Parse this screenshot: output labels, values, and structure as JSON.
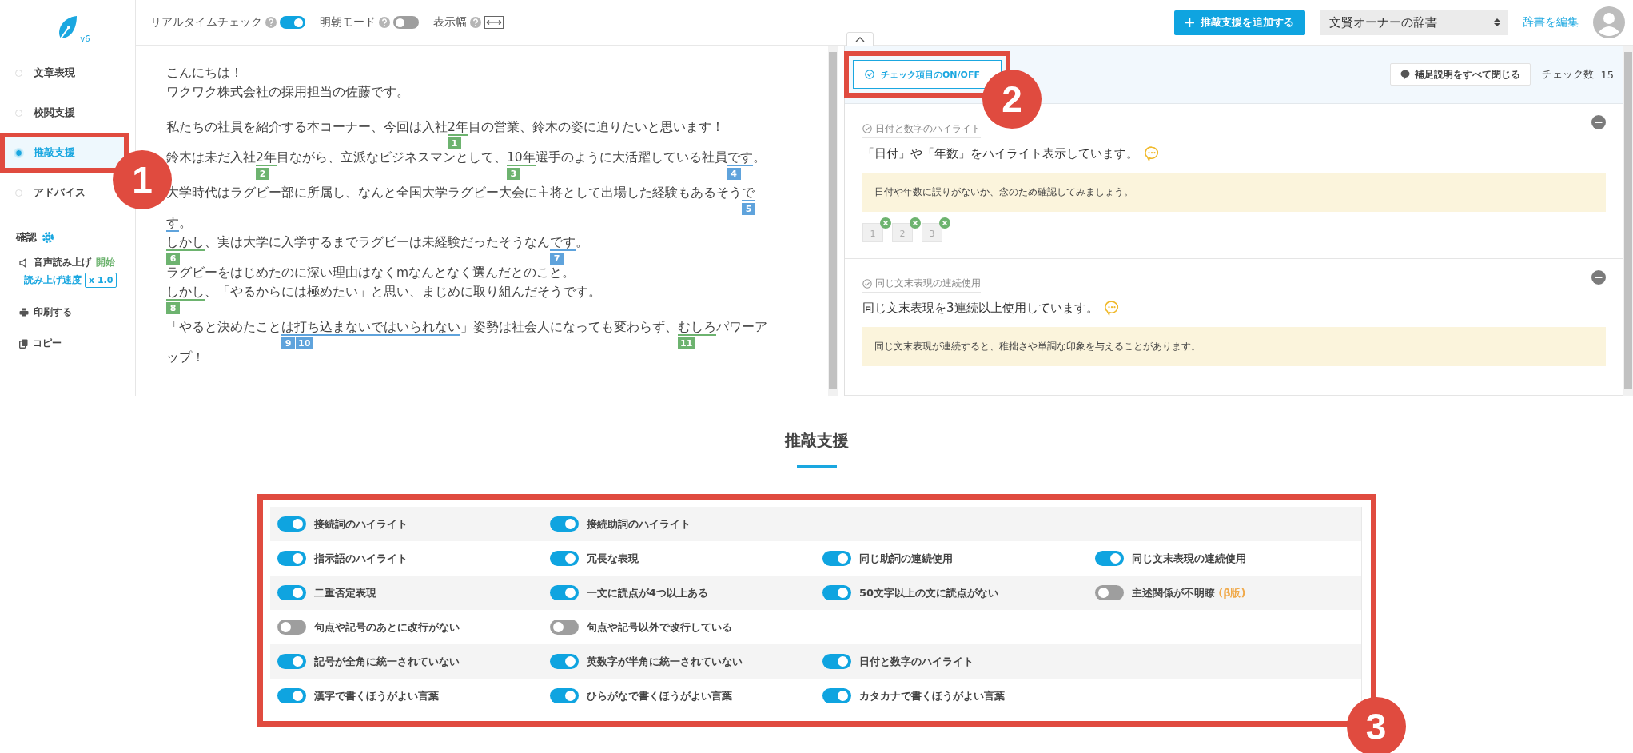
{
  "sidebar": {
    "logo_version": "v6",
    "nav": [
      {
        "label": "文章表現",
        "selected": false
      },
      {
        "label": "校閲支援",
        "selected": false
      },
      {
        "label": "推敲支援",
        "selected": true,
        "annotation": "1"
      },
      {
        "label": "アドバイス",
        "selected": false
      }
    ],
    "confirm": {
      "title": "確認",
      "speech_label": "音声読み上げ",
      "speech_action": "開始",
      "speed_label": "読み上げ速度",
      "speed": "x 1.0",
      "print": "印刷する",
      "copy": "コピー"
    }
  },
  "toolbar": {
    "toggles": [
      {
        "label": "リアルタイムチェック",
        "kind": "switch",
        "on": true
      },
      {
        "label": "明朝モード",
        "kind": "switch",
        "on": false
      },
      {
        "label": "表示幅",
        "kind": "width"
      }
    ],
    "add_button": "推敲支援を追加する",
    "dictionary": "文賢オーナーの辞書",
    "edit_link": "辞書を編集"
  },
  "editor": {
    "paragraphs": [
      {
        "lines": [
          [
            {
              "text": "こんにちは！"
            }
          ],
          [
            {
              "text": "ワクワク株式会社の採用担当の佐藤です。"
            }
          ]
        ]
      },
      {
        "lines": [
          [
            {
              "text": "私たちの社員を紹介する本コーナー、今回は入社"
            },
            {
              "text": "2年",
              "color": "#6db36f",
              "marks": [
                "1"
              ]
            },
            {
              "text": "目の営業、鈴木の姿に迫りたいと思います！"
            }
          ],
          [
            {
              "text": "鈴木は未だ入社"
            },
            {
              "text": "2年",
              "color": "#6db36f",
              "marks": [
                "2"
              ]
            },
            {
              "text": "目ながら、立派なビジネスマンとして、"
            },
            {
              "text": "10年",
              "color": "#6db36f",
              "marks": [
                "3"
              ]
            },
            {
              "text": "選手のように大活躍している社員"
            },
            {
              "text": "です",
              "color": "#5fa3dc",
              "marks": [
                "4"
              ]
            },
            {
              "text": "。"
            }
          ]
        ]
      },
      {
        "lines": [
          [
            {
              "text": "大学時代はラグビー部に所属し、なんと全国大学ラグビー大会に主将として出場した経験もあるそう"
            },
            {
              "text": "で",
              "color": "#5fa3dc",
              "marks": [
                "5"
              ]
            }
          ],
          [
            {
              "text": "す",
              "color": "#5fa3dc"
            },
            {
              "text": "。"
            }
          ],
          [
            {
              "text": "しかし",
              "color": "#6db36f",
              "marks": [
                "6"
              ]
            },
            {
              "text": "、実は大学に入学するまでラグビーは未経験だったそうなん"
            },
            {
              "text": "です",
              "color": "#5fa3dc",
              "marks": [
                "7"
              ]
            },
            {
              "text": "。"
            }
          ],
          [
            {
              "text": "ラグビーをはじめたのに深い理由はなくmなんとなく選んだとのこと。"
            }
          ],
          [
            {
              "text": "しかし",
              "color": "#6db36f",
              "marks": [
                "8"
              ]
            },
            {
              "text": "、「やるからには極めたい」と思い、まじめに取り組んだそうです。"
            }
          ]
        ]
      },
      {
        "lines": [
          [
            {
              "text": "「やると決めたこと"
            },
            {
              "text": "は打ち込まないではいられない",
              "color": "#5fa3dc",
              "marks": [
                "9",
                "10"
              ]
            },
            {
              "text": "」姿勢は社会人になっても変わらず、"
            },
            {
              "text": "むしろ",
              "color": "#6db36f",
              "marks": [
                "11"
              ]
            },
            {
              "text": "パワーア"
            }
          ],
          [
            {
              "text": "ップ！"
            }
          ]
        ]
      }
    ]
  },
  "panel": {
    "onoff_button": {
      "label": "チェック項目のON/OFF",
      "annotation": "2"
    },
    "close_all": "補足説明をすべて閉じる",
    "count_label": "チェック数",
    "count": "15",
    "cards": [
      {
        "category": "日付と数字のハイライト",
        "message": "「日付」や「年数」をハイライト表示しています。",
        "note": "日付や年数に誤りがないか、念のため確認してみましょう。",
        "chips": [
          "1",
          "2",
          "3"
        ]
      },
      {
        "category": "同じ文末表現の連続使用",
        "message": "同じ文末表現を3連続以上使用しています。",
        "note": "同じ文末表現が連続すると、稚拙さや単調な印象を与えることがあります。"
      }
    ]
  },
  "settings": {
    "title": "推敲支援",
    "annotation": "3",
    "rows": [
      [
        {
          "label": "接続詞のハイライト",
          "on": true
        },
        {
          "label": "接続助詞のハイライト",
          "on": true
        }
      ],
      [
        {
          "label": "指示語のハイライト",
          "on": true
        },
        {
          "label": "冗長な表現",
          "on": true
        },
        {
          "label": "同じ助詞の連続使用",
          "on": true
        },
        {
          "label": "同じ文末表現の連続使用",
          "on": true
        }
      ],
      [
        {
          "label": "二重否定表現",
          "on": true
        },
        {
          "label": "一文に読点が4つ以上ある",
          "on": true
        },
        {
          "label": "50文字以上の文に読点がない",
          "on": true
        },
        {
          "label": "主述関係が不明瞭",
          "on": false,
          "tag": "(β版)"
        }
      ],
      [
        {
          "label": "句点や記号のあとに改行がない",
          "on": false
        },
        {
          "label": "句点や記号以外で改行している",
          "on": false
        }
      ],
      [
        {
          "label": "記号が全角に統一されていない",
          "on": true
        },
        {
          "label": "英数字が半角に統一されていない",
          "on": true
        },
        {
          "label": "日付と数字のハイライト",
          "on": true
        }
      ],
      [
        {
          "label": "漢字で書くほうがよい言葉",
          "on": true
        },
        {
          "label": "ひらがなで書くほうがよい言葉",
          "on": true
        },
        {
          "label": "カタカナで書くほうがよい言葉",
          "on": true
        }
      ]
    ]
  }
}
